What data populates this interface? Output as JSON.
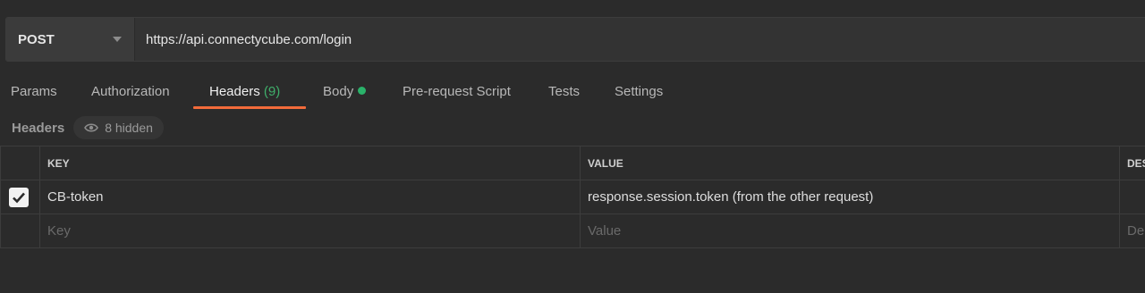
{
  "request": {
    "method": "POST",
    "url": "https://api.connectycube.com/login"
  },
  "tabs": [
    {
      "label": "Params"
    },
    {
      "label": "Authorization"
    },
    {
      "label": "Headers",
      "count": "(9)"
    },
    {
      "label": "Body"
    },
    {
      "label": "Pre-request Script"
    },
    {
      "label": "Tests"
    },
    {
      "label": "Settings"
    }
  ],
  "headers_section": {
    "title": "Headers",
    "hidden_label": "8 hidden"
  },
  "table": {
    "columns": [
      "KEY",
      "VALUE",
      "DES"
    ],
    "rows": [
      {
        "checked": true,
        "key": "CB-token",
        "value": "response.session.token (from the other request)",
        "description": ""
      }
    ],
    "placeholder": {
      "key": "Key",
      "value": "Value",
      "description": "De"
    }
  },
  "colors": {
    "active_tab_underline": "#f26b3a",
    "count_green": "#3fae6a",
    "body_dot": "#2ab26a",
    "background": "#2b2b2b"
  }
}
